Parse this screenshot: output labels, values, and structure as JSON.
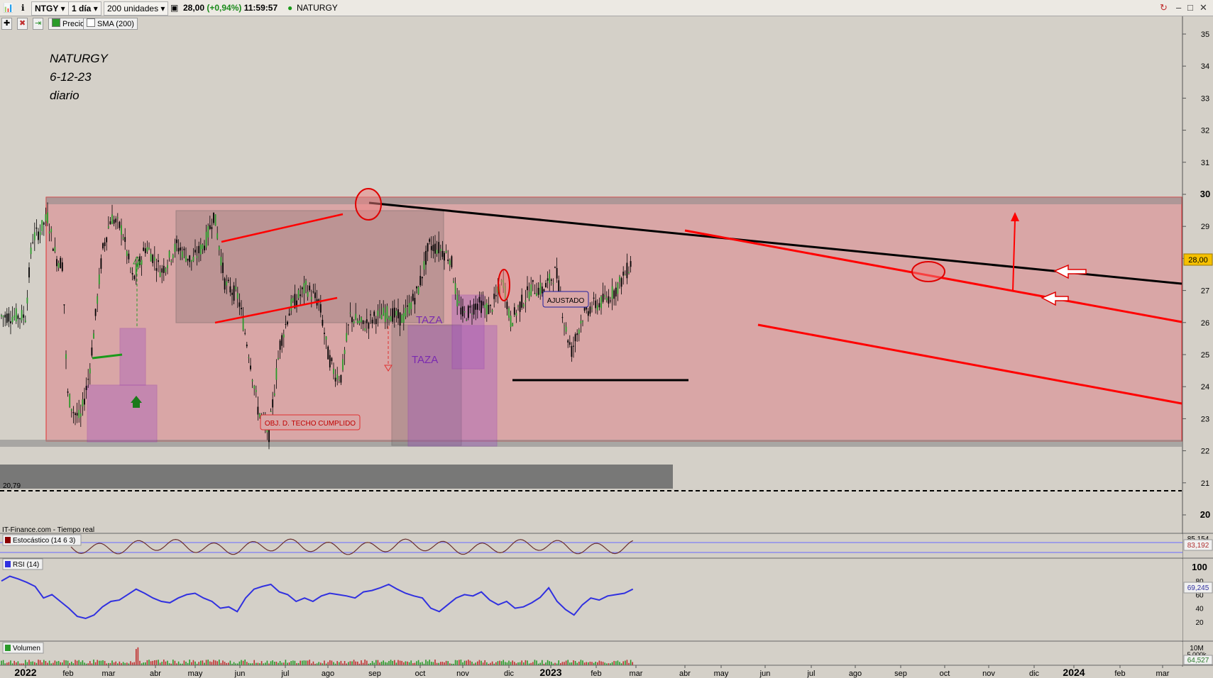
{
  "toolbar": {
    "symbol": "NTGY",
    "period": "1 día",
    "units": "200 unidades",
    "price": "28,00",
    "change": "(+0,94%)",
    "time": "11:59:57",
    "name": "NATURGY"
  },
  "indicators_bar": {
    "precio": "Precio",
    "sma": "SMA (200)"
  },
  "annotations": {
    "title_line1": "NATURGY",
    "title_line2": "6-12-23",
    "title_line3": "diario",
    "taza1": "TAZA",
    "taza2": "TAZA",
    "ajustado": "AJUSTADO",
    "objetivo": "OBJ. D. TECHO CUMPLIDO",
    "level_2079": "20,79",
    "source": "IT-Finance.com - Tiempo real"
  },
  "colors": {
    "bg": "#d4d0c8",
    "zone": "#d9a6a6",
    "zone_border": "#e03030",
    "trend_red": "#ff0000",
    "trend_black": "#000000",
    "rsi": "#3030e0",
    "price_tag": "#f5c000"
  },
  "chart_data": {
    "type": "candlestick",
    "x_ticks": [
      "2022",
      "feb",
      "mar",
      "abr",
      "may",
      "jun",
      "jul",
      "ago",
      "sep",
      "oct",
      "nov",
      "dic",
      "2023",
      "feb",
      "mar",
      "abr",
      "may",
      "jun",
      "jul",
      "ago",
      "sep",
      "oct",
      "nov",
      "dic",
      "2024",
      "feb",
      "mar"
    ],
    "y_ticks": [
      "35",
      "34",
      "33",
      "32",
      "31",
      "30",
      "29",
      "28",
      "27",
      "26",
      "25",
      "24",
      "23",
      "22",
      "21",
      "20"
    ],
    "ylim": [
      19.8,
      35.3
    ],
    "last_price": "28,00",
    "approx_close_path": [
      [
        0,
        26.2
      ],
      [
        0.15,
        28.6
      ],
      [
        0.35,
        28.9
      ],
      [
        0.5,
        29.3
      ],
      [
        0.7,
        28.0
      ],
      [
        0.85,
        27.8
      ],
      [
        0.95,
        23.8
      ],
      [
        1.1,
        23.2
      ],
      [
        1.25,
        23.0
      ],
      [
        1.45,
        24.4
      ],
      [
        1.55,
        25.6
      ],
      [
        1.75,
        28.2
      ],
      [
        1.95,
        29.3
      ],
      [
        2.2,
        28.9
      ],
      [
        2.45,
        27.3
      ],
      [
        2.75,
        28.4
      ],
      [
        3.1,
        27.6
      ],
      [
        3.45,
        28.4
      ],
      [
        3.8,
        27.9
      ],
      [
        4.1,
        28.5
      ],
      [
        4.3,
        29.4
      ],
      [
        4.55,
        27.2
      ],
      [
        4.85,
        26.8
      ],
      [
        5.1,
        25.0
      ],
      [
        5.3,
        23.3
      ],
      [
        5.55,
        22.5
      ],
      [
        5.8,
        25.3
      ],
      [
        6.05,
        26.5
      ],
      [
        6.4,
        27.1
      ],
      [
        6.7,
        26.6
      ],
      [
        6.9,
        25.0
      ],
      [
        7.05,
        24.4
      ],
      [
        7.2,
        24.3
      ],
      [
        7.4,
        26.2
      ],
      [
        7.7,
        25.9
      ],
      [
        8.0,
        26.2
      ],
      [
        8.3,
        26.3
      ],
      [
        8.6,
        26.1
      ],
      [
        8.95,
        27.0
      ],
      [
        9.2,
        28.4
      ],
      [
        9.45,
        28.3
      ],
      [
        9.7,
        28.0
      ],
      [
        9.85,
        26.6
      ],
      [
        10.0,
        26.2
      ],
      [
        10.3,
        26.6
      ],
      [
        10.6,
        26.4
      ],
      [
        10.9,
        27.3
      ],
      [
        11.05,
        26.0
      ],
      [
        11.3,
        26.6
      ],
      [
        11.55,
        27.1
      ],
      [
        11.8,
        27.0
      ],
      [
        12.1,
        27.6
      ],
      [
        12.3,
        25.9
      ],
      [
        12.45,
        25.1
      ],
      [
        12.7,
        26.2
      ],
      [
        12.9,
        26.5
      ],
      [
        13.1,
        26.6
      ],
      [
        13.3,
        26.8
      ],
      [
        13.5,
        27.1
      ],
      [
        13.75,
        27.7
      ],
      [
        13.85,
        28.0
      ]
    ],
    "sma_200": "rendered hidden",
    "stochastic": {
      "label": "Estocástico (14 6 3)",
      "last": "83,192",
      "upper": "85,154"
    },
    "rsi": {
      "label": "RSI (14)",
      "last": "69,245",
      "ticks": [
        "100",
        "80",
        "60",
        "40",
        "20"
      ],
      "approx_values": [
        80,
        87,
        83,
        78,
        72,
        55,
        60,
        50,
        40,
        28,
        25,
        30,
        42,
        50,
        52,
        60,
        68,
        62,
        55,
        50,
        48,
        55,
        60,
        62,
        55,
        50,
        40,
        42,
        35,
        55,
        68,
        72,
        75,
        64,
        60,
        50,
        55,
        50,
        58,
        62,
        60,
        58,
        55,
        64,
        66,
        70,
        75,
        68,
        62,
        58,
        55,
        40,
        35,
        45,
        55,
        60,
        58,
        64,
        52,
        45,
        50,
        40,
        42,
        48,
        56,
        70,
        50,
        38,
        30,
        45,
        55,
        52,
        58,
        60,
        62,
        68
      ]
    },
    "volume": {
      "label": "Volumen",
      "last": "64,527",
      "ticks": [
        "10M",
        "5,000k"
      ]
    }
  }
}
